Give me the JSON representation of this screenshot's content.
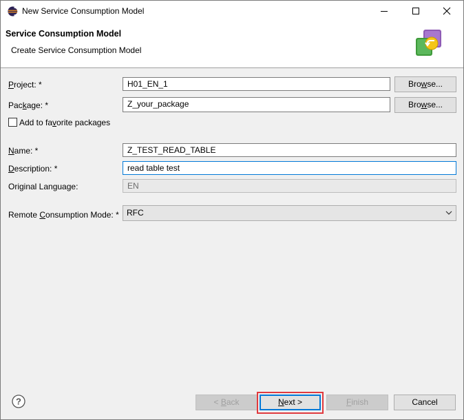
{
  "window": {
    "title": "New Service Consumption Model"
  },
  "banner": {
    "title": "Service Consumption Model",
    "subtitle": "Create Service Consumption Model"
  },
  "form": {
    "project_label_pre": "",
    "project_label_u": "P",
    "project_label_post": "roject: *",
    "project_value": "H01_EN_1",
    "package_label_pre": "Pac",
    "package_label_u": "k",
    "package_label_post": "age: *",
    "package_value": "Z_your_package",
    "browse_pre": "Bro",
    "browse_u": "w",
    "browse_post": "se...",
    "favorite_pre": "Add to fa",
    "favorite_u": "v",
    "favorite_post": "orite packages",
    "favorite_checked": false,
    "name_label_pre": "",
    "name_label_u": "N",
    "name_label_post": "ame: *",
    "name_value": "Z_TEST_READ_TABLE",
    "description_label_pre": "",
    "description_label_u": "D",
    "description_label_post": "escription: *",
    "description_value": "read table test",
    "language_label": "Original Language:",
    "language_value": "EN",
    "mode_label_pre": "Remote ",
    "mode_label_u": "C",
    "mode_label_post": "onsumption Mode: *",
    "mode_value": "RFC"
  },
  "footer": {
    "back_pre": "< ",
    "back_u": "B",
    "back_post": "ack",
    "next_pre": "",
    "next_u": "N",
    "next_post": "ext >",
    "finish_pre": "",
    "finish_u": "F",
    "finish_post": "inish",
    "cancel": "Cancel",
    "help_icon": "help-icon"
  },
  "colors": {
    "highlight": "#e0393e",
    "focus": "#0078d7"
  }
}
